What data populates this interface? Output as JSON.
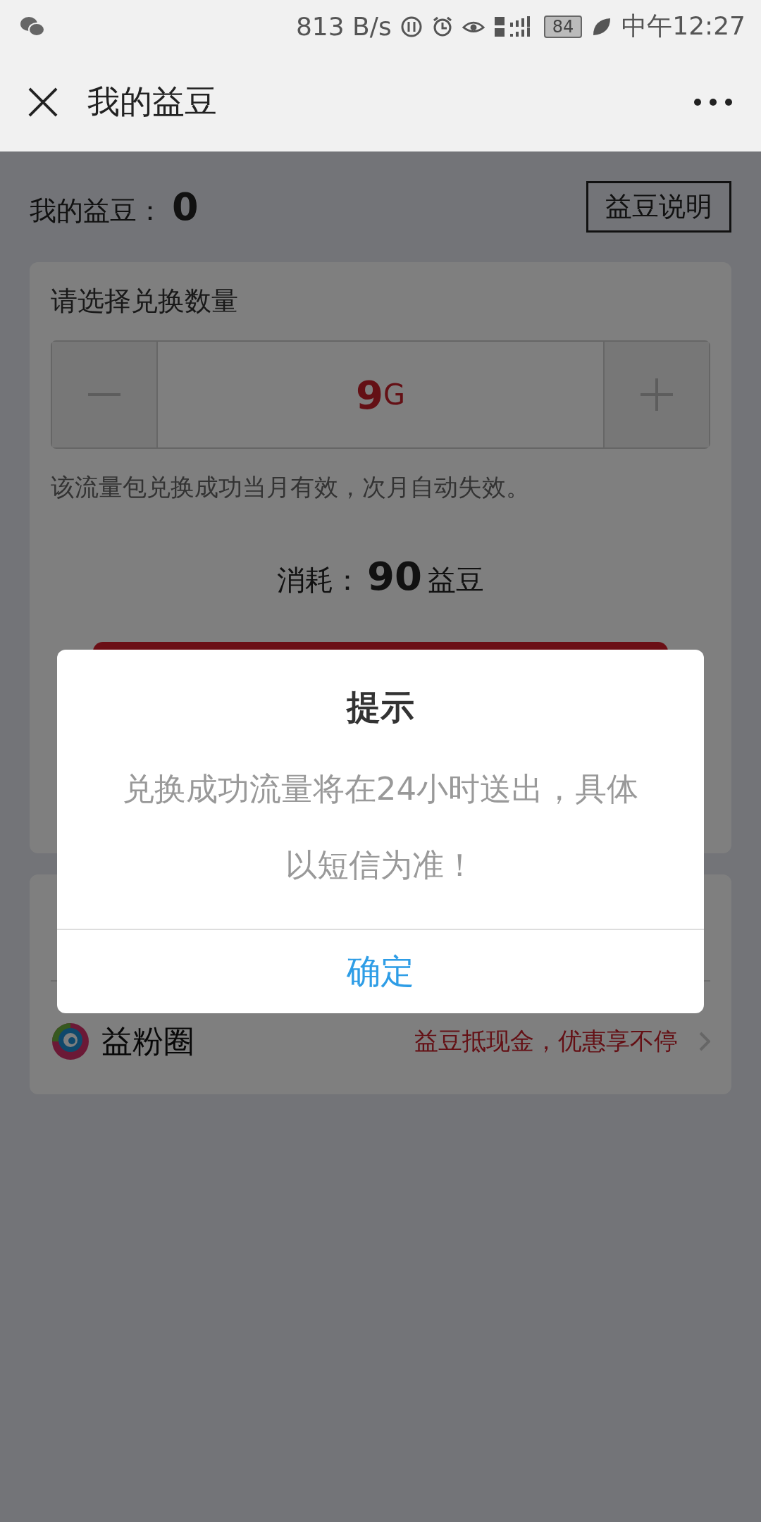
{
  "status_bar": {
    "speed": "813 B/s",
    "battery": "84",
    "time": "中午12:27"
  },
  "header": {
    "title": "我的益豆"
  },
  "balance": {
    "label": "我的益豆：",
    "value": "0",
    "help_button": "益豆说明"
  },
  "exchange": {
    "title": "请选择兑换数量",
    "stepper": {
      "value": "9",
      "unit": "G"
    },
    "note": "该流量包兑换成功当月有效，次月自动失效。",
    "cost": {
      "label": "消耗：",
      "value": "90",
      "unit": "益豆"
    }
  },
  "links": [
    {
      "name": "益粉圈",
      "promo": "益豆抵现金，优惠享不停"
    }
  ],
  "dialog": {
    "title": "提示",
    "message": "兑换成功流量将在24小时送出，具体以短信为准！",
    "confirm": "确定"
  }
}
